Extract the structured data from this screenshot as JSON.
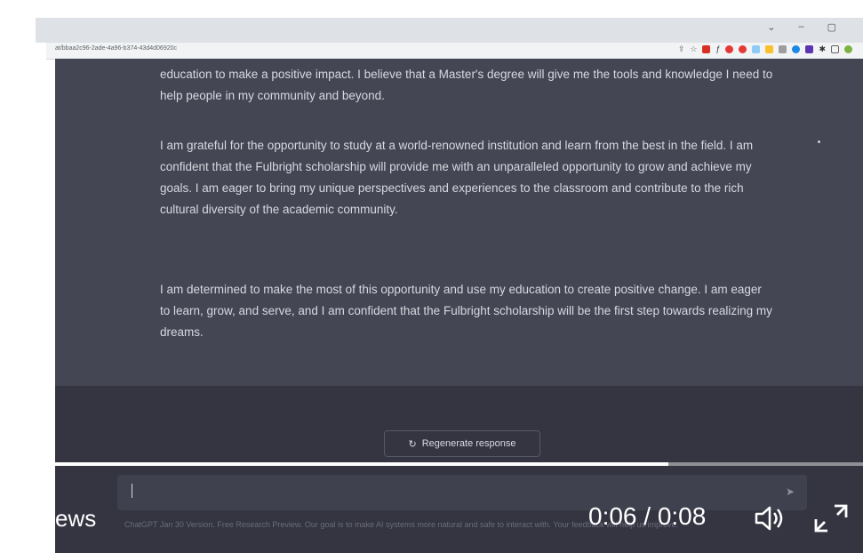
{
  "browser": {
    "url": "at/bbaa2c96-2ade-4a96-b374-43d4d06920c",
    "window_controls": [
      "⌄",
      "–",
      "▢"
    ]
  },
  "chat": {
    "paragraphs": [
      "education to make a positive impact. I believe that a Master's degree will give me the tools and knowledge I need to help people in my community and beyond.",
      "I am grateful for the opportunity to study at a world-renowned institution and learn from the best in the field. I am confident that the Fulbright scholarship will provide me with an unparalleled opportunity to grow and achieve my goals. I am eager to bring my unique perspectives and experiences to the classroom and contribute to the rich cultural diversity of the academic community.",
      "I am determined to make the most of this opportunity and use my education to create positive change. I am eager to learn, grow, and serve, and I am confident that the Fulbright scholarship will be the first step towards realizing my dreams."
    ],
    "regenerate_label": "Regenerate response",
    "footer": "ChatGPT Jan 30 Version. Free Research Preview. Our goal is to make AI systems more natural and safe to interact with. Your feedback will help us improve."
  },
  "video": {
    "caption_fragment": "ews",
    "time": "0:06 / 0:08",
    "progress": 0.76
  },
  "colors": {
    "chat_bg": "#444654",
    "bottom_bg": "#343541",
    "input_bg": "#40414f",
    "text": "#d8d8e0"
  }
}
